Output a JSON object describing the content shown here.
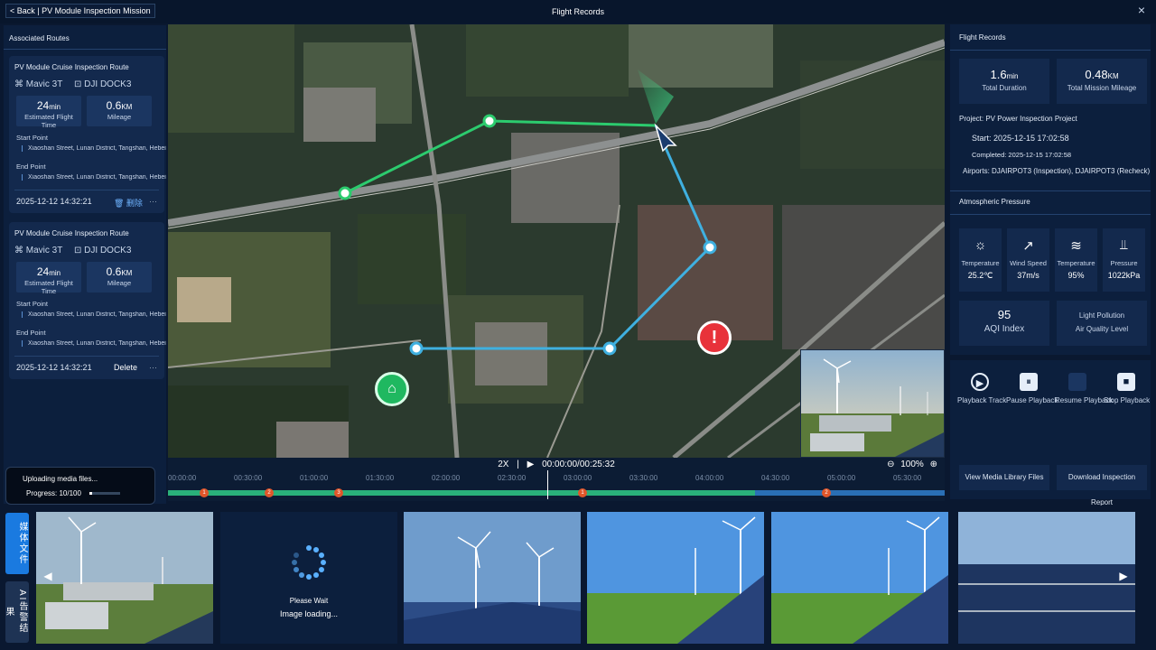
{
  "header": {
    "back_label": "< Back | PV Module Inspection Mission",
    "title": "Flight Records",
    "close_icon": "×"
  },
  "left": {
    "title": "Associated Routes",
    "routes": [
      {
        "name": "PV Module Cruise Inspection Route",
        "drone": "Mavic 3T",
        "dock": "DJI DOCK3",
        "time_value": "24",
        "time_unit": "min",
        "time_label": "Estimated Flight Time",
        "mileage_value": "0.6",
        "mileage_unit": "KM",
        "mileage_label": "Mileage",
        "start_label": "Start Point",
        "start_value": "Xiaoshan Street, Lunan District, Tangshan, Hebei",
        "end_label": "End Point",
        "end_value": "Xiaoshan Street, Lunan District, Tangshan, Hebei",
        "date": "2025-12-12 14:32:21",
        "delete_label": "🗑 删除",
        "more": "···"
      },
      {
        "name": "PV Module Cruise Inspection Route",
        "drone": "Mavic 3T",
        "dock": "DJI DOCK3",
        "time_value": "24",
        "time_unit": "min",
        "time_label": "Estimated Flight Time",
        "mileage_value": "0.6",
        "mileage_unit": "KM",
        "mileage_label": "Mileage",
        "start_label": "Start Point",
        "start_value": "Xiaoshan Street, Lunan District, Tangshan, Hebei",
        "end_label": "End Point",
        "end_value": "Xiaoshan Street, Lunan District, Tangshan, Hebei",
        "date": "2025-12-12 14:32:21",
        "delete_label": "Delete",
        "more": "···"
      }
    ]
  },
  "timeline": {
    "speed": "2X",
    "time": "00:00:00/00:25:32",
    "zoom": "100%",
    "ticks": [
      "00:00:00",
      "00:30:00",
      "01:00:00",
      "01:30:00",
      "02:00:00",
      "02:30:00",
      "03:00:00",
      "03:30:00",
      "04:00:00",
      "04:30:00",
      "05:00:00",
      "05:30:00"
    ],
    "markers": [
      "1",
      "2",
      "3",
      "1",
      "2"
    ]
  },
  "right": {
    "title": "Flight Records",
    "duration_value": "1.6",
    "duration_unit": "min",
    "duration_label": "Total Duration",
    "mileage_value": "0.48",
    "mileage_unit": "KM",
    "mileage_label": "Total Mission Mileage",
    "project": "Project: PV Power Inspection Project",
    "start": "Start:  2025-12-15 17:02:58",
    "completed": "Completed: 2025-12-15 17:02:58",
    "airports": "Airports: DJAIRPOT3 (Inspection), DJAIRPOT3 (Recheck)",
    "atmo_title": "Atmospheric Pressure",
    "weather": [
      {
        "icon": "☼",
        "label": "Temperature",
        "value": "25.2℃"
      },
      {
        "icon": "↗",
        "label": "Wind Speed",
        "value": "37m/s"
      },
      {
        "icon": "≋",
        "label": "Temperature",
        "value": "95%"
      },
      {
        "icon": "⫫",
        "label": "Pressure",
        "value": "1022kPa"
      }
    ],
    "aqi_value": "95",
    "aqi_label": "AQI Index",
    "light_label": "Light Pollution",
    "light_value": "Air Quality Level"
  },
  "controls": {
    "playback_track": "Playback Track",
    "pause": "Pause Playback",
    "resume": "Resume Playback",
    "stop": "Stop Playback",
    "view_media": "View Media Library Files",
    "download": "Download Inspection Report"
  },
  "upload": {
    "title": "Uploading media files...",
    "progress": "Progress: 10/100",
    "progress_fraction": 0.1
  },
  "bottom": {
    "tab_media": "媒体文件",
    "tab_ai": "AI告警结果",
    "wait": "Please Wait",
    "loading": "Image loading..."
  }
}
